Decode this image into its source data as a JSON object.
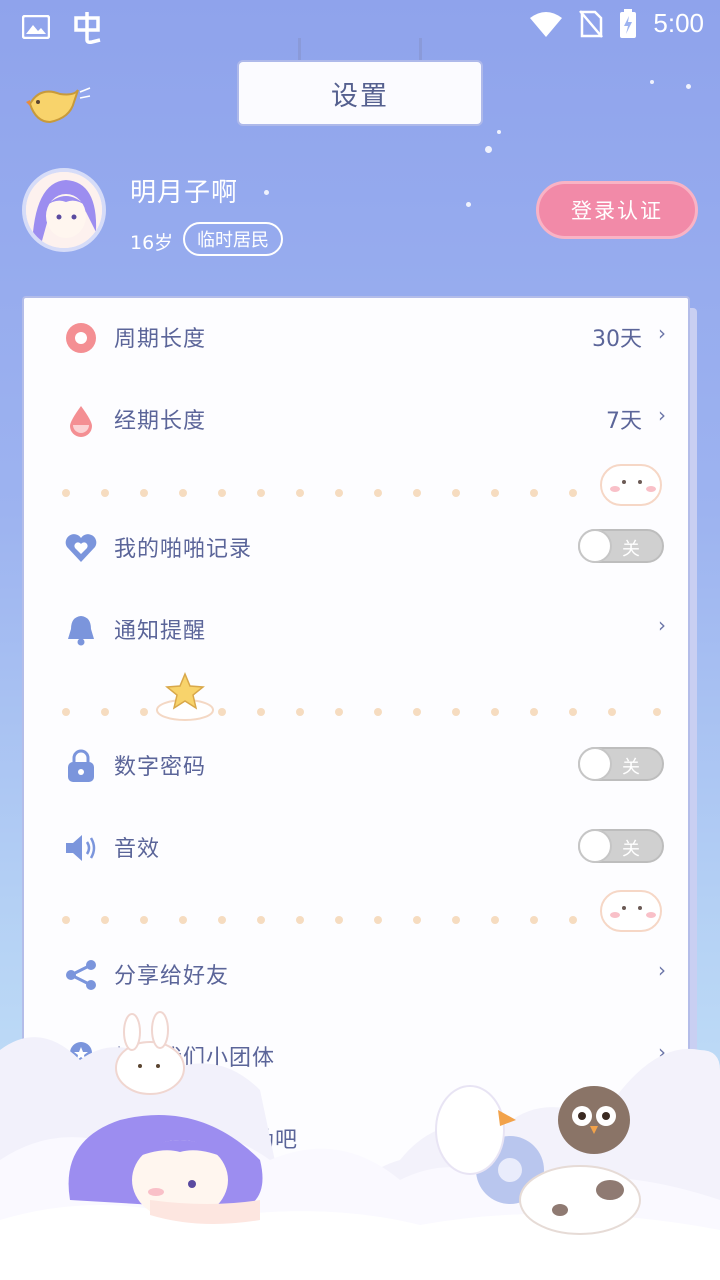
{
  "status_bar": {
    "time": "5:00"
  },
  "header": {
    "title": "设置"
  },
  "profile": {
    "name": "明月子啊",
    "age": "16岁",
    "badge": "临时居民",
    "login_button": "登录认证"
  },
  "settings": [
    {
      "label": "周期长度",
      "value": "30天",
      "icon": "circle-icon",
      "type": "link"
    },
    {
      "label": "经期长度",
      "value": "7天",
      "icon": "drop-icon",
      "type": "link"
    },
    {
      "label": "我的啪啪记录",
      "value": "关",
      "icon": "heart-icon",
      "type": "toggle"
    },
    {
      "label": "通知提醒",
      "value": "",
      "icon": "bell-icon",
      "type": "link"
    },
    {
      "label": "数字密码",
      "value": "关",
      "icon": "lock-icon",
      "type": "toggle"
    },
    {
      "label": "音效",
      "value": "关",
      "icon": "speaker-icon",
      "type": "toggle"
    },
    {
      "label": "分享给好友",
      "value": "",
      "icon": "share-icon",
      "type": "link"
    },
    {
      "label": "加入我们小团体",
      "value": "",
      "icon": "badge-icon",
      "type": "link"
    },
    {
      "label": "给个好评点鼓励吧",
      "value": "",
      "icon": "thumb-icon",
      "type": "link"
    }
  ],
  "chevron": "›",
  "colors": {
    "accent": "#f28aa8",
    "text": "#5b6599",
    "background": "#9db3f0"
  }
}
